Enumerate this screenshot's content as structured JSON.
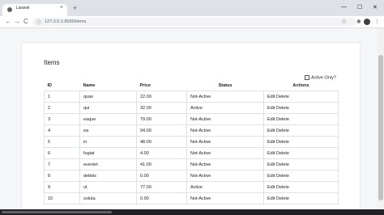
{
  "browser": {
    "tab_title": "Laravel",
    "tab_close": "×",
    "new_tab": "+",
    "min": "—",
    "max": "☐",
    "close": "✕",
    "url": "127.0.0.1:8000/items",
    "back": "←",
    "forward": "→",
    "reload": "C",
    "star": "☆",
    "ext_icon": "puzzle-icon",
    "menu": "⋮"
  },
  "page": {
    "heading": "Items",
    "filter_label": "Active Only?",
    "filter_checked": false
  },
  "table": {
    "headers": [
      "ID",
      "Name",
      "Price",
      "Status",
      "Actions"
    ],
    "rows": [
      {
        "id": "1",
        "name": "quas",
        "price": "22.00",
        "status": "Not-Active",
        "edit": "Edit",
        "delete": "Delete"
      },
      {
        "id": "2",
        "name": "qui",
        "price": "32.00",
        "status": "Active",
        "edit": "Edit",
        "delete": "Delete"
      },
      {
        "id": "3",
        "name": "eaque",
        "price": "79.00",
        "status": "Not-Active",
        "edit": "Edit",
        "delete": "Delete"
      },
      {
        "id": "4",
        "name": "ea",
        "price": "94.00",
        "status": "Not-Active",
        "edit": "Edit",
        "delete": "Delete"
      },
      {
        "id": "5",
        "name": "in",
        "price": "48.00",
        "status": "Not-Active",
        "edit": "Edit",
        "delete": "Delete"
      },
      {
        "id": "6",
        "name": "fugiat",
        "price": "4.00",
        "status": "Not-Active",
        "edit": "Edit",
        "delete": "Delete"
      },
      {
        "id": "7",
        "name": "eveniet",
        "price": "41.00",
        "status": "Not-Active",
        "edit": "Edit",
        "delete": "Delete"
      },
      {
        "id": "8",
        "name": "debitis",
        "price": "0.00",
        "status": "Not-Active",
        "edit": "Edit",
        "delete": "Delete"
      },
      {
        "id": "9",
        "name": "ut",
        "price": "77.00",
        "status": "Active",
        "edit": "Edit",
        "delete": "Delete"
      },
      {
        "id": "10",
        "name": "soluta",
        "price": "0.00",
        "status": "Not-Active",
        "edit": "Edit",
        "delete": "Delete"
      }
    ]
  }
}
